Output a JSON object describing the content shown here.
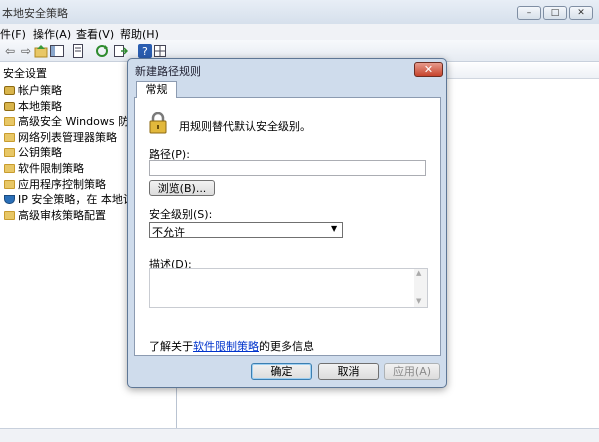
{
  "window": {
    "title": "本地安全策略",
    "min": "–",
    "max": "□",
    "close": "✕"
  },
  "menu": {
    "file": "件(F)",
    "action": "操作(A)",
    "view": "查看(V)",
    "help": "帮助(H)"
  },
  "toolbar": {
    "back": "⇦",
    "forward": "⇨"
  },
  "tree": {
    "root": "安全设置",
    "items": [
      {
        "label": "帐户策略",
        "icon": "lock"
      },
      {
        "label": "本地策略",
        "icon": "lock"
      },
      {
        "label": "高级安全 Windows 防火墙",
        "icon": "folder"
      },
      {
        "label": "网络列表管理器策略",
        "icon": "folder"
      },
      {
        "label": "公钥策略",
        "icon": "folder"
      },
      {
        "label": "软件限制策略",
        "icon": "folder"
      },
      {
        "label": "应用程序控制策略",
        "icon": "folder"
      },
      {
        "label": "IP 安全策略，在 本地计算机",
        "icon": "shield"
      },
      {
        "label": "高级审核策略配置",
        "icon": "folder"
      }
    ]
  },
  "dialog": {
    "title": "新建路径规则",
    "close": "✕",
    "tab": "常规",
    "description": "用规则替代默认安全级别。",
    "path_label": "路径(P):",
    "path_value": "",
    "browse": "浏览(B)...",
    "security_label": "安全级别(S):",
    "security_value": "不允许",
    "desc_label": "描述(D):",
    "desc_value": "",
    "info_prefix": "了解关于",
    "info_link": "软件限制策略",
    "info_suffix": "的更多信息",
    "ok": "确定",
    "cancel": "取消",
    "apply": "应用(A)"
  },
  "colors": {
    "link": "#0033cc",
    "dialog_frame": "#cfdcec"
  }
}
